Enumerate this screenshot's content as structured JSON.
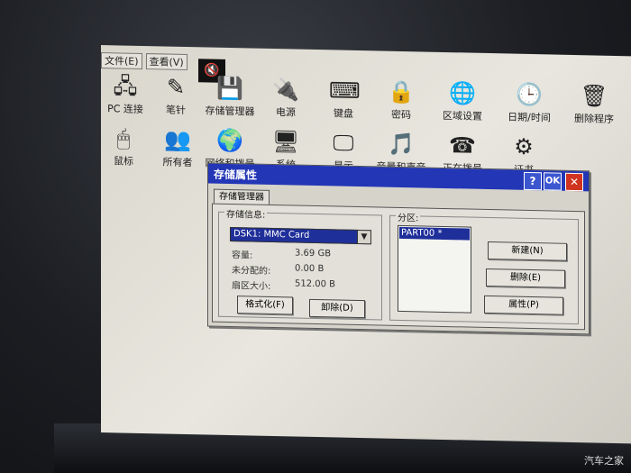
{
  "menu": {
    "file": "文件(E)",
    "view": "查看(V)"
  },
  "icons": [
    {
      "label": "PC 连接",
      "glyph": "🖧"
    },
    {
      "label": "笔针",
      "glyph": "✎"
    },
    {
      "label": "存储管理器",
      "glyph": "💾"
    },
    {
      "label": "电源",
      "glyph": "🔌"
    },
    {
      "label": "键盘",
      "glyph": "⌨"
    },
    {
      "label": "密码",
      "glyph": "🔒"
    },
    {
      "label": "区域设置",
      "glyph": "🌐"
    },
    {
      "label": "日期/时间",
      "glyph": "🕒"
    },
    {
      "label": "删除程序",
      "glyph": "🗑"
    },
    {
      "label": "鼠标",
      "glyph": "🖱"
    },
    {
      "label": "所有者",
      "glyph": "👥"
    },
    {
      "label": "网络和拨号",
      "glyph": "🌍"
    },
    {
      "label": "系统",
      "glyph": "🖥"
    },
    {
      "label": "显示",
      "glyph": "🖵"
    },
    {
      "label": "音量和声音",
      "glyph": "🎵"
    },
    {
      "label": "正在拨号",
      "glyph": "☎"
    },
    {
      "label": "证书",
      "glyph": "⚙"
    }
  ],
  "dialog": {
    "title": "存储属性",
    "help_btn": "?",
    "ok_btn": "OK",
    "close_btn": "✕",
    "tab": "存储管理器",
    "storage_info_label": "存储信息:",
    "selected_storage": "DSK1: MMC Card",
    "capacity_label": "容量:",
    "capacity_value": "3.69 GB",
    "unallocated_label": "未分配的:",
    "unallocated_value": "0.00 B",
    "sector_label": "扇区大小:",
    "sector_value": "512.00 B",
    "format_btn": "格式化(F)",
    "unmount_btn": "卸除(D)",
    "partition_label": "分区:",
    "partitions": [
      "PART00 *"
    ],
    "new_btn": "新建(N)",
    "delete_btn": "删除(E)",
    "properties_btn": "属性(P)"
  },
  "watermark": "汽车之家"
}
